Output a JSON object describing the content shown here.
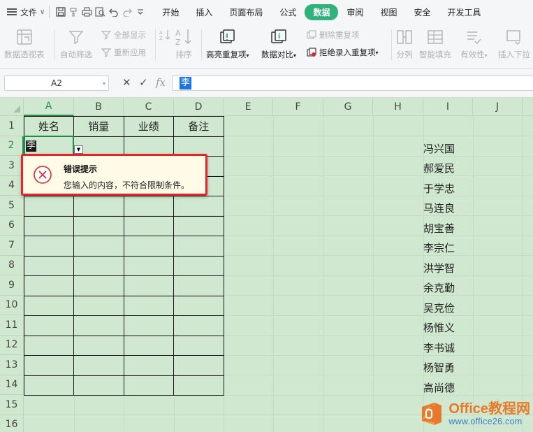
{
  "menubar": {
    "file_label": "文件",
    "tabs": [
      {
        "label": "开始",
        "active": false
      },
      {
        "label": "插入",
        "active": false
      },
      {
        "label": "页面布局",
        "active": false
      },
      {
        "label": "公式",
        "active": false
      },
      {
        "label": "数据",
        "active": true
      },
      {
        "label": "审阅",
        "active": false
      },
      {
        "label": "视图",
        "active": false
      },
      {
        "label": "安全",
        "active": false
      },
      {
        "label": "开发工具",
        "active": false
      }
    ]
  },
  "ribbon": {
    "pivot_table": "数据透视表",
    "auto_filter": "自动筛选",
    "show_all": "全部显示",
    "reapply": "重新应用",
    "sort": "排序",
    "highlight_duplicates": "高亮重复项",
    "data_compare": "数据对比",
    "remove_duplicates": "删除重复项",
    "reject_duplicates": "拒绝录入重复项",
    "split": "分列",
    "flash_fill": "智能填充",
    "validation": "有效性",
    "insert_dropdown": "插入下拉"
  },
  "formula_bar": {
    "name_box": "A2",
    "fx_label": "fx",
    "value": "李"
  },
  "grid": {
    "columns": [
      "A",
      "B",
      "C",
      "D",
      "E",
      "F",
      "G",
      "H",
      "I",
      "J"
    ],
    "selected_column": "A",
    "rows": [
      "1",
      "2",
      "3",
      "4",
      "5",
      "6",
      "7",
      "8",
      "9",
      "10",
      "11",
      "12",
      "13",
      "14",
      "15",
      "16"
    ],
    "selected_row": "2",
    "headers": [
      "姓名",
      "销量",
      "业绩",
      "备注"
    ],
    "active_cell_value": "李",
    "name_list": [
      "冯兴国",
      "郝爱民",
      "于学忠",
      "马连良",
      "胡宝善",
      "李宗仁",
      "洪学智",
      "余克勤",
      "吴克俭",
      "杨惟义",
      "李书诚",
      "杨智勇",
      "高尚德"
    ]
  },
  "error_tip": {
    "title": "错误提示",
    "message": "您输入的内容，不符合限制条件。"
  },
  "watermark": {
    "line1": "Office教程网",
    "line2": "www.office26.com"
  },
  "colors": {
    "accent": "#2fb37a",
    "grid_bg": "#cfe8cf",
    "error_border": "#e8232a",
    "error_bg": "#fffbe6"
  }
}
